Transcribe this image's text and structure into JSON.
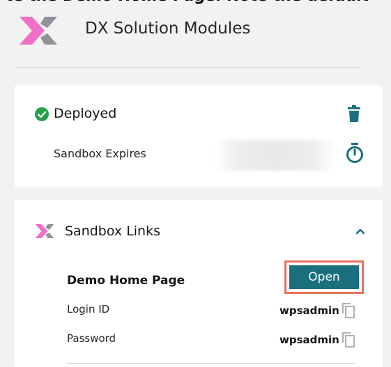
{
  "header": {
    "banner_fragment": "te the Demo Home Page. Note the default",
    "title": "DX Solution Modules"
  },
  "status_card": {
    "status": "Deployed",
    "expires_label": "Sandbox Expires"
  },
  "links_card": {
    "title": "Sandbox Links",
    "demo_label": "Demo Home Page",
    "open_label": "Open",
    "login_label": "Login ID",
    "login_value": "wpsadmin",
    "password_label": "Password",
    "password_value": "wpsadmin"
  },
  "colors": {
    "success": "#24a148",
    "open_button": "#1b6f7d",
    "highlight": "#e76f5e",
    "logo_pink": "#f06ec8",
    "logo_gray": "#8d9398"
  },
  "icons": [
    "check-circle-icon",
    "trash-icon",
    "timer-icon",
    "chevron-up-icon",
    "copy-icon",
    "dx-logo-icon"
  ]
}
